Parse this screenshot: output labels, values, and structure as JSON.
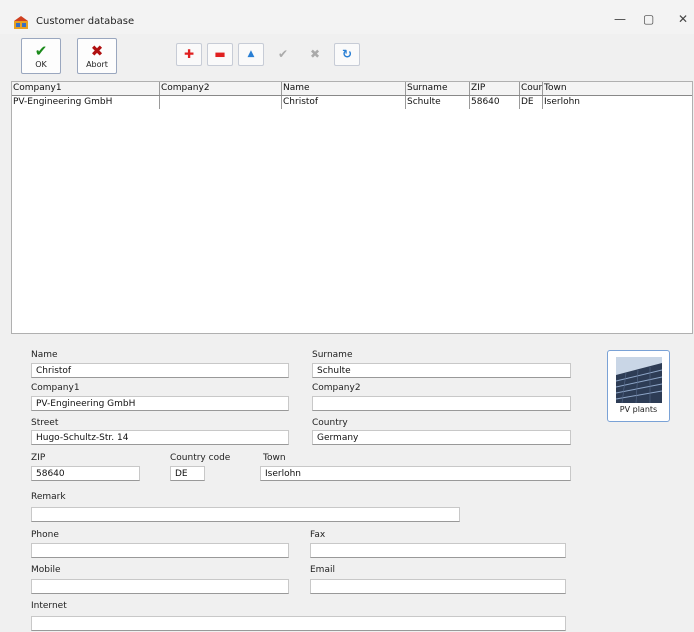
{
  "window": {
    "title": "Customer database",
    "minimize": "—",
    "maximize": "▢",
    "close": "✕"
  },
  "toolbar": {
    "ok_label": "OK",
    "abort_label": "Abort",
    "add_glyph": "✚",
    "remove_glyph": "▬",
    "up_glyph": "▲",
    "confirm_glyph": "✔",
    "cancel_glyph": "✖",
    "refresh_glyph": "↻",
    "colors": {
      "ok": "#1a8a1a",
      "abort": "#b01010",
      "add": "#e02020",
      "remove": "#e02020",
      "up": "#2a7fd4",
      "refresh": "#2a7fd4",
      "disabled": "#aaaaaa"
    }
  },
  "grid": {
    "columns": [
      "Company1",
      "Company2",
      "Name",
      "Surname",
      "ZIP",
      "Coun",
      "Town"
    ],
    "rows": [
      [
        "PV-Engineering GmbH",
        "",
        "Christof",
        "Schulte",
        "58640",
        "DE",
        "Iserlohn"
      ]
    ]
  },
  "form": {
    "name": {
      "label": "Name",
      "value": "Christof"
    },
    "surname": {
      "label": "Surname",
      "value": "Schulte"
    },
    "company1": {
      "label": "Company1",
      "value": "PV-Engineering GmbH"
    },
    "company2": {
      "label": "Company2",
      "value": ""
    },
    "street": {
      "label": "Street",
      "value": "Hugo-Schultz-Str. 14"
    },
    "country": {
      "label": "Country",
      "value": "Germany"
    },
    "zip": {
      "label": "ZIP",
      "value": "58640"
    },
    "country_code": {
      "label": "Country code",
      "value": "DE"
    },
    "town": {
      "label": "Town",
      "value": "Iserlohn"
    },
    "remark": {
      "label": "Remark",
      "value": ""
    },
    "phone": {
      "label": "Phone",
      "value": ""
    },
    "fax": {
      "label": "Fax",
      "value": ""
    },
    "mobile": {
      "label": "Mobile",
      "value": ""
    },
    "email": {
      "label": "Email",
      "value": ""
    },
    "internet": {
      "label": "Internet",
      "value": ""
    }
  },
  "pv_button": {
    "label": "PV plants",
    "icon": "solar-panels-image"
  }
}
